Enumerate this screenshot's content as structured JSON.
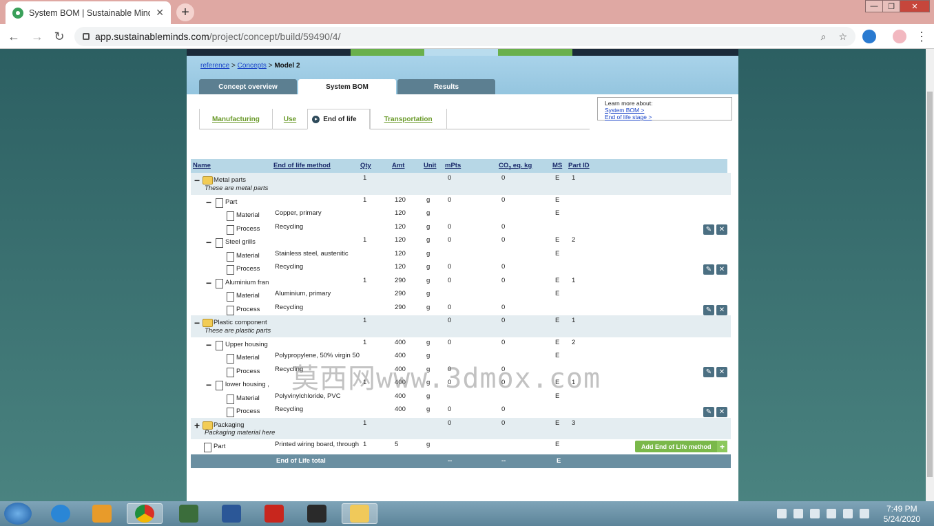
{
  "browser": {
    "tab_title": "System BOM | Sustainable Minds",
    "new_tab": "+",
    "tab_close": "✕",
    "url_host": "app.sustainableminds.com",
    "url_path": "/project/concept/build/59490/4/",
    "win_min": "—",
    "win_max": "❐",
    "win_close": "✕"
  },
  "breadcrumb": {
    "link1": "reference",
    "sep": ">",
    "link2": "Concepts",
    "current": "Model 2"
  },
  "main_tabs": [
    "Concept overview",
    "System BOM",
    "Results"
  ],
  "sub_tabs": {
    "manufacturing": "Manufacturing",
    "use": "Use",
    "eol": "End of life",
    "transport": "Transportation"
  },
  "learn": {
    "title": "Learn more about:",
    "link1": "System BOM >",
    "link2": "End of life stage >"
  },
  "columns": {
    "name": "Name",
    "method": "End of life method",
    "qty": "Qty",
    "amt": "Amt",
    "unit": "Unit",
    "mpts": "mPts",
    "co2": "CO",
    "co2_sub": "2",
    "co2_rest": " eq. kg",
    "ms": "MS",
    "partid": "Part ID"
  },
  "rows": {
    "r1": {
      "name": "Metal parts",
      "qty": "1",
      "mpts": "0",
      "co2": "0",
      "ms": "E",
      "pid": "1",
      "desc": "These are metal parts"
    },
    "r2": {
      "name": "Part",
      "qty": "1",
      "amt": "120",
      "unit": "g",
      "mpts": "0",
      "co2": "0",
      "ms": "E"
    },
    "r3": {
      "name": "Material",
      "method": "Copper, primary",
      "amt": "120",
      "unit": "g",
      "ms": "E"
    },
    "r4": {
      "name": "Process",
      "method": "Recycling",
      "amt": "120",
      "unit": "g",
      "mpts": "0",
      "co2": "0"
    },
    "r5": {
      "name": "Steel grills",
      "qty": "1",
      "amt": "120",
      "unit": "g",
      "mpts": "0",
      "co2": "0",
      "ms": "E",
      "pid": "2"
    },
    "r6": {
      "name": "Material",
      "method": "Stainless steel, austenitic",
      "amt": "120",
      "unit": "g",
      "ms": "E"
    },
    "r7": {
      "name": "Process",
      "method": "Recycling",
      "amt": "120",
      "unit": "g",
      "mpts": "0",
      "co2": "0"
    },
    "r8": {
      "name": "Aluminium fran",
      "qty": "1",
      "amt": "290",
      "unit": "g",
      "mpts": "0",
      "co2": "0",
      "ms": "E",
      "pid": "1"
    },
    "r9": {
      "name": "Material",
      "method": "Aluminium, primary",
      "amt": "290",
      "unit": "g",
      "ms": "E"
    },
    "r10": {
      "name": "Process",
      "method": "Recycling",
      "amt": "290",
      "unit": "g",
      "mpts": "0",
      "co2": "0"
    },
    "r11": {
      "name": "Plastic component",
      "qty": "1",
      "mpts": "0",
      "co2": "0",
      "ms": "E",
      "pid": "1",
      "desc": "These are plastic parts"
    },
    "r12": {
      "name": "Upper housing",
      "qty": "1",
      "amt": "400",
      "unit": "g",
      "mpts": "0",
      "co2": "0",
      "ms": "E",
      "pid": "2"
    },
    "r13": {
      "name": "Material",
      "method": "Polypropylene, 50% virgin 50",
      "amt": "400",
      "unit": "g",
      "ms": "E"
    },
    "r14": {
      "name": "Process",
      "method": "Recycling",
      "amt": "400",
      "unit": "g",
      "mpts": "0",
      "co2": "0"
    },
    "r15": {
      "name": "lower housing ,",
      "qty": "1",
      "amt": "400",
      "unit": "g",
      "mpts": "0",
      "co2": "0",
      "ms": "E",
      "pid": "1"
    },
    "r16": {
      "name": "Material",
      "method": "Polyvinylchloride, PVC",
      "amt": "400",
      "unit": "g",
      "ms": "E"
    },
    "r17": {
      "name": "Process",
      "method": "Recycling",
      "amt": "400",
      "unit": "g",
      "mpts": "0",
      "co2": "0"
    },
    "r18": {
      "name": "Packaging",
      "qty": "1",
      "mpts": "0",
      "co2": "0",
      "ms": "E",
      "pid": "3",
      "desc": "Packaging material here"
    },
    "r19": {
      "name": "Part",
      "method": "Printed wiring board, through",
      "qty": "1",
      "amt": "5",
      "unit": "g",
      "ms": "E"
    }
  },
  "add_button": "Add End of Life method",
  "add_plus": "+",
  "total": {
    "label": "End of Life total",
    "mpts": "--",
    "co2": "--",
    "ms": "E"
  },
  "watermark": "莫西网www.3dmox.com",
  "taskbar": {
    "time": "7:49 PM",
    "date": "5/24/2020"
  },
  "colors": {
    "accent_green": "#7ab84a",
    "tab_blue": "#5c7f91",
    "header_blue": "#b7d7e6"
  }
}
